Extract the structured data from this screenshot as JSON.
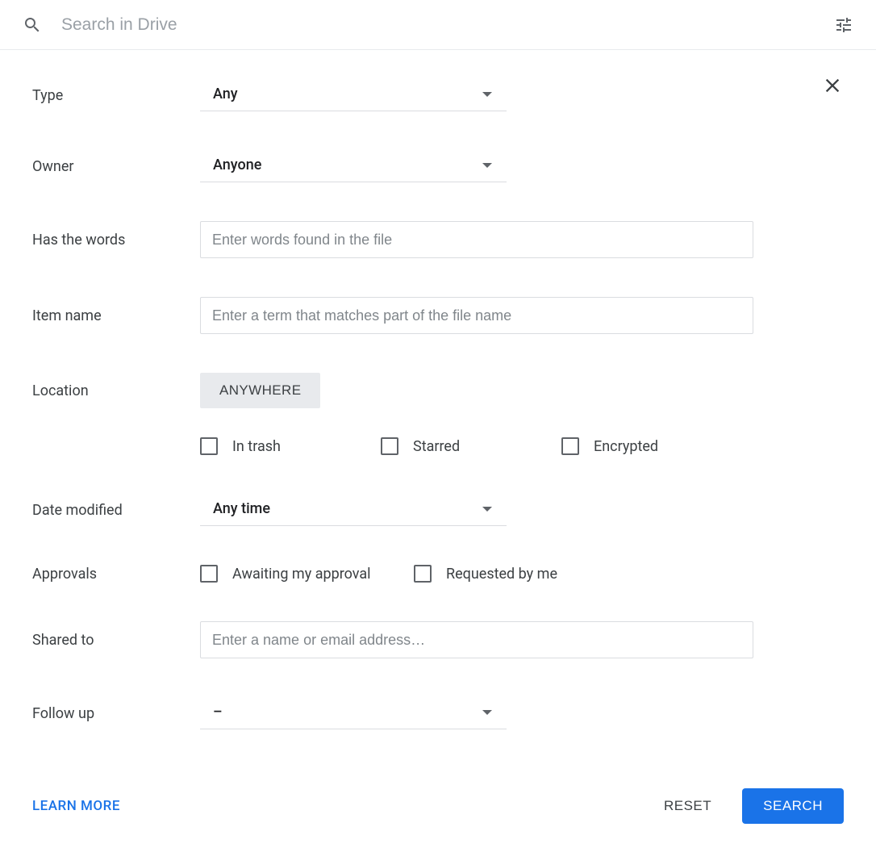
{
  "searchBar": {
    "placeholder": "Search in Drive"
  },
  "form": {
    "type": {
      "label": "Type",
      "value": "Any"
    },
    "owner": {
      "label": "Owner",
      "value": "Anyone"
    },
    "hasWords": {
      "label": "Has the words",
      "placeholder": "Enter words found in the file"
    },
    "itemName": {
      "label": "Item name",
      "placeholder": "Enter a term that matches part of the file name"
    },
    "location": {
      "label": "Location",
      "chip": "ANYWHERE",
      "checkboxes": {
        "inTrash": "In trash",
        "starred": "Starred",
        "encrypted": "Encrypted"
      }
    },
    "dateModified": {
      "label": "Date modified",
      "value": "Any time"
    },
    "approvals": {
      "label": "Approvals",
      "checkboxes": {
        "awaiting": "Awaiting my approval",
        "requested": "Requested by me"
      }
    },
    "sharedTo": {
      "label": "Shared to",
      "placeholder": "Enter a name or email address…"
    },
    "followUp": {
      "label": "Follow up",
      "value": "–"
    }
  },
  "footer": {
    "learnMore": "Learn more",
    "reset": "Reset",
    "search": "Search"
  }
}
